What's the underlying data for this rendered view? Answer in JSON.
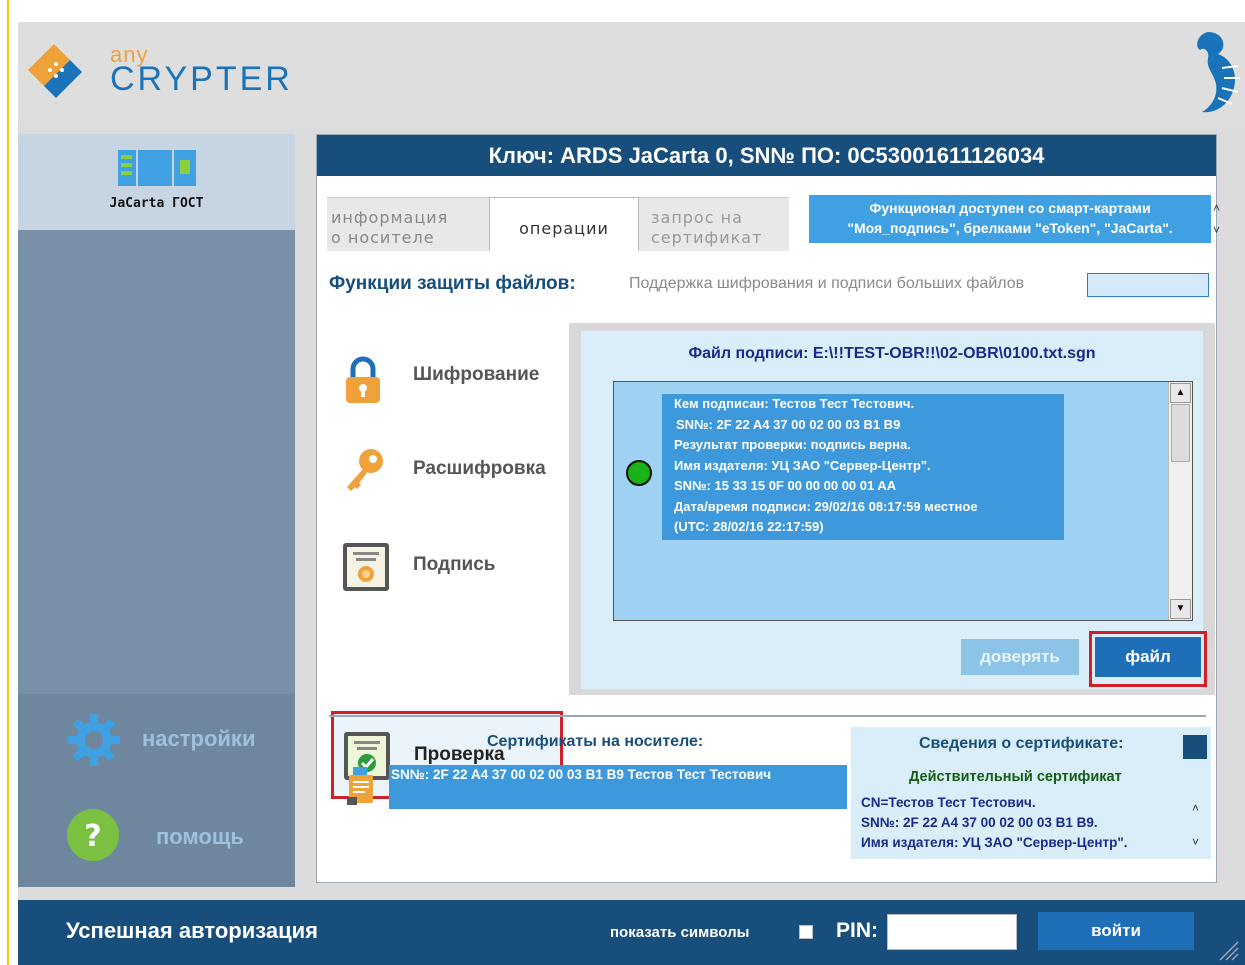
{
  "header": {
    "logo_small": "any",
    "logo_large": "CRYPTER"
  },
  "sidebar": {
    "device_label": "JaCarta ГОСТ",
    "settings_label": "настройки",
    "help_label": "помощь"
  },
  "main": {
    "key_title": "Ключ: ARDS JaCarta 0, SN№ ПО: 0C53001611126034",
    "tabs": [
      {
        "line1": "информация",
        "line2": "о носителе"
      },
      {
        "line1": "операции"
      },
      {
        "line1": "запрос на",
        "line2": "сертификат"
      }
    ],
    "notice_line1": "Функционал доступен со смарт-картами",
    "notice_line2": "\"Моя_подпись\", брелками \"eToken\", \"JaCarta\".",
    "functions_title": "Функции защиты файлов:",
    "functions_sub": "Поддержка шифрования и подписи больших файлов",
    "operations": [
      {
        "label": "Шифрование",
        "icon": "lock-icon"
      },
      {
        "label": "Расшифровка",
        "icon": "key-icon"
      },
      {
        "label": "Подпись",
        "icon": "certificate-icon"
      },
      {
        "label": "Проверка",
        "icon": "verify-certificate-icon"
      }
    ],
    "selected_operation": "Проверка",
    "signature_file": "Файл подписи: E:\\!!TEST-OBR!!\\02-OBR\\0100.txt.sgn",
    "verification_lines": [
      "Кем подписан: Тестов Тест Тестович.",
      "SN№: 2F 22 A4 37 00 02 00 03 B1 B9",
      "Результат проверки: подпись верна.",
      "Имя издателя: УЦ ЗАО \"Сервер-Центр\".",
      "SN№: 15 33 15 0F 00 00 00 00 01 AA",
      "Дата/время подписи: 29/02/16 08:17:59 местное",
      "(UTC: 28/02/16 22:17:59)"
    ],
    "status_color": "#19b219",
    "trust_button": "доверять",
    "file_button": "файл",
    "certs_title": "Сертификаты на носителе:",
    "cert_row": "SN№: 2F 22 A4 37 00 02 00 03 B1 B9  Тестов Тест Тестович",
    "cert_info_title": "Сведения о сертификате:",
    "cert_valid": "Действительный сертификат",
    "cert_info_lines": [
      "CN=Тестов Тест Тестович.",
      "SN№: 2F 22 A4 37 00 02 00 03 B1 B9.",
      "Имя издателя: УЦ ЗАО \"Сервер-Центр\"."
    ]
  },
  "footer": {
    "status": "Успешная авторизация",
    "show_symbols": "показать символы",
    "pin_label": "PIN:",
    "login_button": "войти"
  },
  "colors": {
    "brand_dark": "#174e7b",
    "accent_blue": "#3d99dc",
    "highlight_red": "#d0202a",
    "logo_orange": "#f0a23a"
  }
}
